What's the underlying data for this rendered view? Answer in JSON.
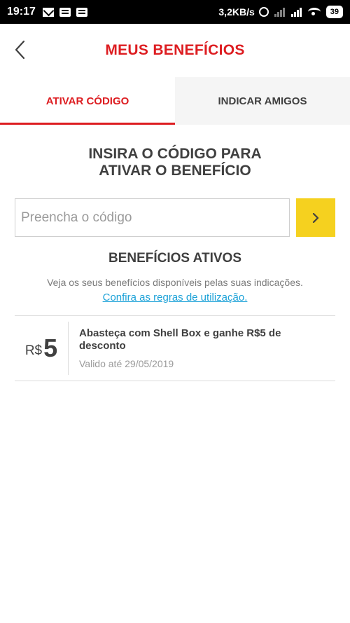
{
  "status_bar": {
    "time": "19:17",
    "speed": "3,2KB/s",
    "battery": "39"
  },
  "header": {
    "title": "MEUS BENEFÍCIOS"
  },
  "tabs": [
    {
      "label": "ATIVAR CÓDIGO",
      "active": true
    },
    {
      "label": "INDICAR AMIGOS",
      "active": false
    }
  ],
  "activate": {
    "instruction_line1": "INSIRA O CÓDIGO PARA",
    "instruction_line2": "ATIVAR O BENEFÍCIO",
    "input_placeholder": "Preencha o código",
    "input_value": ""
  },
  "active_benefits": {
    "title": "BENEFÍCIOS ATIVOS",
    "description": "Veja os seus benefícios disponíveis pelas suas indicações.",
    "rules_link": "Confira as regras de utilização.",
    "items": [
      {
        "currency": "R$",
        "amount": "5",
        "description": "Abasteça com Shell Box e ganhe R$5 de desconto",
        "valid_until": "Valido até 29/05/2019"
      }
    ]
  },
  "colors": {
    "accent_red": "#dd1d21",
    "button_yellow": "#f5d11f",
    "link_blue": "#1da2d8"
  },
  "icons": {
    "back": "chevron-left-icon",
    "submit": "chevron-right-icon"
  }
}
